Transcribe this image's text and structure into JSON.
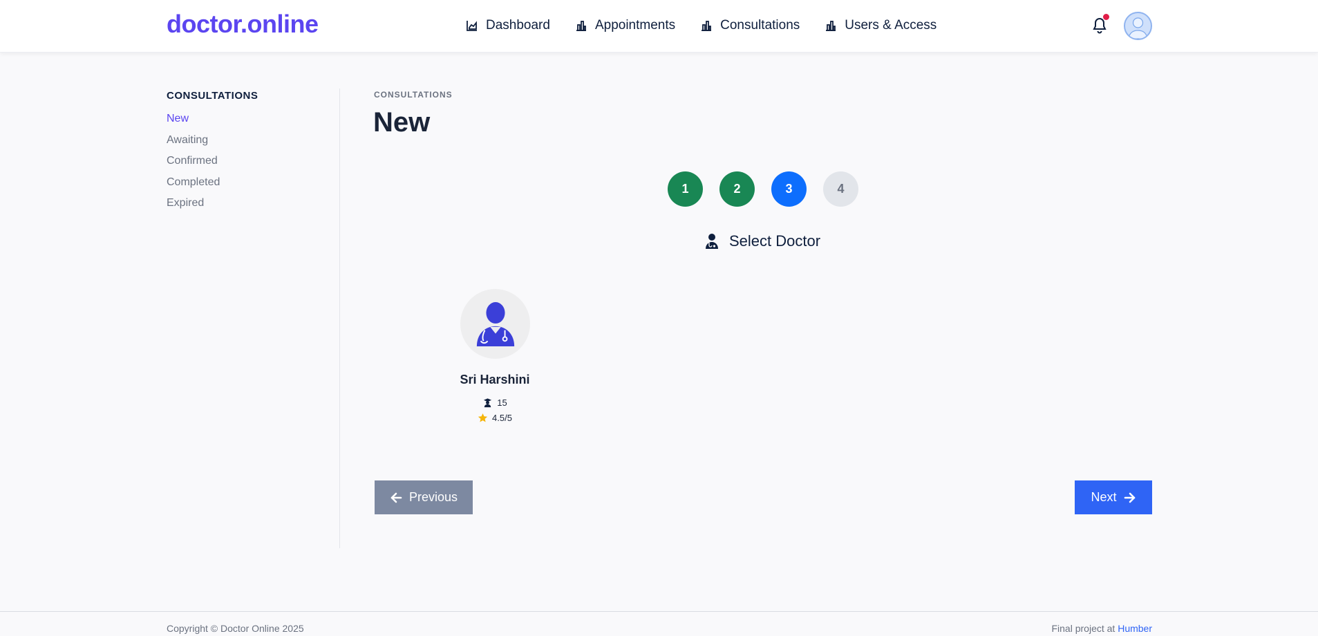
{
  "brand": "doctor.online",
  "nav": [
    {
      "label": "Dashboard",
      "icon": "chart-area-icon"
    },
    {
      "label": "Appointments",
      "icon": "chart-bar-icon"
    },
    {
      "label": "Consultations",
      "icon": "chart-bar-icon"
    },
    {
      "label": "Users & Access",
      "icon": "chart-bar-icon"
    }
  ],
  "sidebar": {
    "title": "CONSULTATIONS",
    "items": [
      {
        "label": "New",
        "active": true
      },
      {
        "label": "Awaiting"
      },
      {
        "label": "Confirmed"
      },
      {
        "label": "Completed"
      },
      {
        "label": "Expired"
      }
    ]
  },
  "main": {
    "eyebrow": "CONSULTATIONS",
    "title": "New",
    "steps": [
      {
        "label": "1",
        "state": "done"
      },
      {
        "label": "2",
        "state": "done"
      },
      {
        "label": "3",
        "state": "current"
      },
      {
        "label": "4",
        "state": "todo"
      }
    ],
    "section_title": "Select Doctor",
    "doctor": {
      "name": "Sri Harshini",
      "experience": "15",
      "rating": "4.5/5"
    },
    "prev_label": "Previous",
    "next_label": "Next"
  },
  "footer": {
    "copyright": "Copyright © Doctor Online 2025",
    "final_prefix": "Final project at ",
    "final_link": "Humber"
  },
  "colors": {
    "brand": "#5b45f0",
    "step_done": "#198754",
    "step_current": "#0d6efd",
    "next_button": "#2f64f5",
    "prev_button": "#7d89a1",
    "notification_dot": "#e11d48",
    "star": "#f5b50a",
    "doctor_icon": "#3b3fd8"
  }
}
